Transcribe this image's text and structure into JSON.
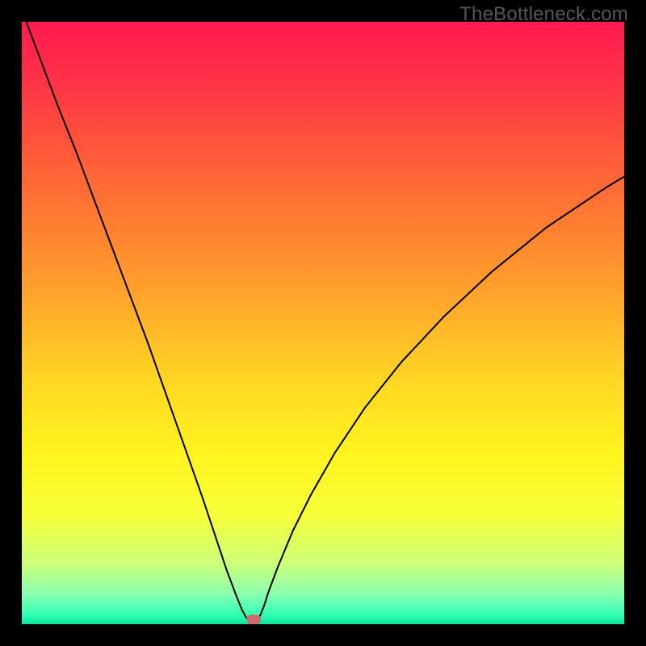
{
  "watermark": "TheBottleneck.com",
  "chart_data": {
    "type": "line",
    "title": "",
    "xlabel": "",
    "ylabel": "",
    "xlim": [
      0,
      100
    ],
    "ylim": [
      0,
      100
    ],
    "background_gradient": {
      "stops": [
        {
          "offset": 0.0,
          "color": "#ff1a4f"
        },
        {
          "offset": 0.1,
          "color": "#ff3246"
        },
        {
          "offset": 0.22,
          "color": "#ff5a3a"
        },
        {
          "offset": 0.35,
          "color": "#ff8230"
        },
        {
          "offset": 0.48,
          "color": "#ffad2a"
        },
        {
          "offset": 0.6,
          "color": "#ffd823"
        },
        {
          "offset": 0.72,
          "color": "#fff41f"
        },
        {
          "offset": 0.82,
          "color": "#f6ff3a"
        },
        {
          "offset": 0.9,
          "color": "#cbff79"
        },
        {
          "offset": 0.95,
          "color": "#8affb0"
        },
        {
          "offset": 0.985,
          "color": "#2effb5"
        },
        {
          "offset": 1.0,
          "color": "#0be49a"
        }
      ]
    },
    "series": [
      {
        "name": "bottleneck-curve",
        "x": [
          0,
          3,
          6,
          9,
          12,
          15,
          18,
          21,
          24,
          27,
          30,
          32,
          34,
          35.5,
          36.5,
          37.2,
          37.8,
          38.3,
          38.7,
          39.0,
          39.5,
          40.2,
          41.0,
          42.5,
          45,
          48,
          52,
          57,
          63,
          70,
          78,
          87,
          97,
          100
        ],
        "y": [
          102,
          94,
          86,
          78.5,
          70.5,
          62.5,
          54.5,
          46.5,
          38,
          29.5,
          21,
          15,
          9,
          5,
          2.5,
          1.2,
          0.5,
          0.3,
          0.3,
          0.5,
          1.3,
          3.0,
          5.5,
          9.5,
          15.5,
          21.5,
          28.5,
          36.0,
          43.5,
          51.0,
          58.5,
          65.8,
          72.5,
          74.3
        ]
      }
    ],
    "marker": {
      "name": "optimal-region",
      "x": 38.5,
      "y": 0.0,
      "width": 2.4,
      "height": 1.6,
      "fill": "#d06a6a",
      "radius": 0.8
    }
  }
}
